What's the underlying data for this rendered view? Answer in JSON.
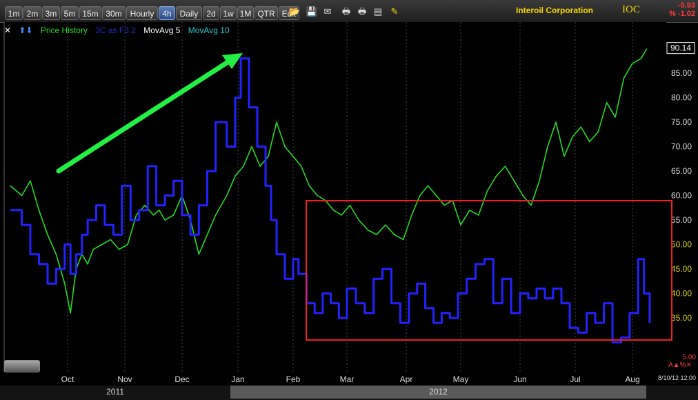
{
  "toolbar": {
    "intervals": [
      "1m",
      "2m",
      "3m",
      "5m",
      "15m",
      "30m",
      "Hourly",
      "4h",
      "Daily",
      "2d",
      "1w",
      "1M",
      "QTR",
      "Edit"
    ],
    "active": "4h",
    "icons": [
      "folder-icon",
      "save-icon",
      "mail-icon",
      "print-icon",
      "print-icon",
      "settings-icon",
      "pencil-icon"
    ]
  },
  "header": {
    "company": "Interoil Corporation",
    "ticker": "IOC",
    "change": "-0.93",
    "change_pct": "% -1.02"
  },
  "legend": [
    {
      "label": "Price History",
      "color": "#22dd22"
    },
    {
      "label": "3C as F3.2",
      "color": "#2222cc"
    },
    {
      "label": "MovAvg 5",
      "color": "#ffffff"
    },
    {
      "label": "MovAvg 10",
      "color": "#22cccc"
    }
  ],
  "chart_data": {
    "type": "line",
    "x_ticks": [
      "Oct",
      "Nov",
      "Dec",
      "Jan",
      "Feb",
      "Mar",
      "Apr",
      "May",
      "Jun",
      "Jul",
      "Aug"
    ],
    "years": [
      "2011",
      "2012"
    ],
    "y_ticks": [
      85.0,
      80.0,
      75.0,
      70.0,
      65.0,
      60.0,
      55.0,
      50.0,
      45.0,
      40.0,
      35.0
    ],
    "ylim": [
      29.5,
      91.5
    ],
    "last_price": "90.14",
    "sub_value": "5.00",
    "date_label": "8/10/12 12:00",
    "series": [
      {
        "name": "Price History",
        "color": "#22dd22",
        "x_month": [
          0.0,
          0.2,
          0.35,
          0.5,
          0.65,
          0.8,
          0.95,
          1.05,
          1.15,
          1.25,
          1.35,
          1.45,
          1.6,
          1.75,
          1.9,
          2.05,
          2.2,
          2.35,
          2.5,
          2.6,
          2.7,
          2.85,
          3.0,
          3.15,
          3.3,
          3.45,
          3.6,
          3.8,
          3.95,
          4.1,
          4.25,
          4.4,
          4.55,
          4.7,
          4.85,
          5.0,
          5.15,
          5.3,
          5.45,
          5.6,
          5.75,
          5.9,
          6.05,
          6.2,
          6.35,
          6.5,
          6.65,
          6.8,
          6.95,
          7.1,
          7.25,
          7.4,
          7.55,
          7.7,
          7.85,
          8.0,
          8.15,
          8.3,
          8.45,
          8.6,
          8.75,
          8.9,
          9.05,
          9.2,
          9.35,
          9.5,
          9.65,
          9.8,
          9.95,
          10.1,
          10.25,
          10.4,
          10.55,
          10.7,
          10.85,
          11.0,
          11.15,
          11.25
        ],
        "values": [
          62,
          60,
          63,
          57,
          52,
          48,
          42,
          36,
          45,
          48,
          46,
          49,
          50,
          51,
          49,
          50,
          56,
          58,
          56,
          57,
          55,
          56,
          60,
          55,
          48,
          52,
          56,
          60,
          64,
          66,
          70,
          66,
          68,
          75,
          70,
          68,
          66,
          62,
          60,
          59,
          57,
          56,
          58,
          55,
          53,
          52,
          54,
          52,
          51,
          56,
          60,
          62,
          60,
          58,
          59,
          54,
          57,
          56,
          61,
          64,
          66,
          63,
          60,
          58,
          63,
          70,
          75,
          68,
          72,
          74,
          71,
          73,
          79,
          76,
          84,
          87,
          88,
          90
        ]
      },
      {
        "name": "3C as F3.2",
        "color": "#2222ff",
        "x_month": [
          0.0,
          0.2,
          0.35,
          0.5,
          0.65,
          0.8,
          0.95,
          1.05,
          1.15,
          1.25,
          1.35,
          1.5,
          1.65,
          1.8,
          1.95,
          2.1,
          2.25,
          2.4,
          2.55,
          2.7,
          2.85,
          3.0,
          3.15,
          3.3,
          3.45,
          3.6,
          3.8,
          3.95,
          4.05,
          4.2,
          4.35,
          4.5,
          4.6,
          4.7,
          4.85,
          5.0,
          5.1,
          5.25,
          5.4,
          5.55,
          5.7,
          5.85,
          6.0,
          6.15,
          6.3,
          6.45,
          6.6,
          6.75,
          6.9,
          7.05,
          7.2,
          7.35,
          7.5,
          7.65,
          7.8,
          7.95,
          8.1,
          8.25,
          8.4,
          8.55,
          8.7,
          8.85,
          9.0,
          9.15,
          9.3,
          9.45,
          9.6,
          9.75,
          9.9,
          10.05,
          10.2,
          10.35,
          10.5,
          10.65,
          10.8,
          10.95,
          11.1,
          11.2,
          11.3
        ],
        "values": [
          57,
          54,
          48,
          46,
          42,
          45,
          50,
          44,
          48,
          52,
          55,
          58,
          54,
          52,
          62,
          55,
          57,
          66,
          58,
          60,
          63,
          56,
          52,
          58,
          65,
          75,
          70,
          80,
          88,
          78,
          70,
          62,
          55,
          48,
          43,
          47,
          44,
          38,
          36,
          40,
          38,
          35,
          41,
          38,
          36,
          43,
          45,
          38,
          34,
          40,
          42,
          37,
          34,
          36,
          35,
          40,
          43,
          46,
          47,
          38,
          43,
          36,
          40,
          39,
          41,
          39,
          41,
          38,
          33,
          32,
          36,
          34,
          38,
          30,
          31,
          36,
          47,
          40,
          34
        ]
      }
    ]
  }
}
